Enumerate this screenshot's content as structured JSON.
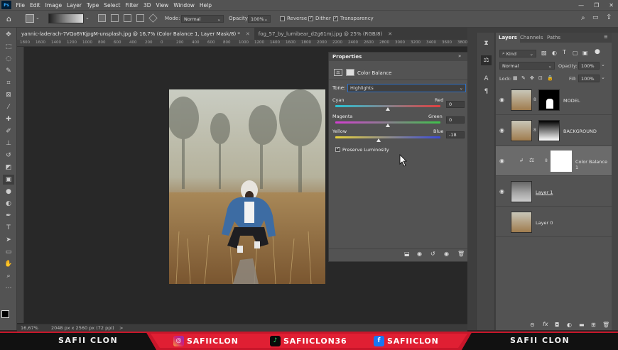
{
  "menu": {
    "items": [
      "File",
      "Edit",
      "Image",
      "Layer",
      "Type",
      "Select",
      "Filter",
      "3D",
      "View",
      "Window",
      "Help"
    ],
    "app_badge": "Ps"
  },
  "options": {
    "mode_label": "Mode:",
    "mode_value": "Normal",
    "opacity_label": "Opacity:",
    "opacity_value": "100%",
    "reverse_label": "Reverse",
    "dither_label": "Dither",
    "transparency_label": "Transparency"
  },
  "tabs": [
    {
      "label": "yannic-laderach-7VQo6YKjpgM-unsplash.jpg @ 16,7% (Color Balance 1, Layer Mask/8) *",
      "active": true
    },
    {
      "label": "fog_57_by_lumibear_d2g61mj.jpg @ 25% (RGB/8)",
      "active": false
    }
  ],
  "ruler": [
    "1800",
    "1600",
    "1400",
    "1200",
    "1000",
    "800",
    "600",
    "400",
    "200",
    "0",
    "200",
    "400",
    "600",
    "800",
    "1000",
    "1200",
    "1400",
    "1600",
    "1800",
    "2000",
    "2200",
    "2400",
    "2600",
    "2800",
    "3000",
    "3200",
    "3400",
    "3600",
    "3800"
  ],
  "status": {
    "zoom": "16,67%",
    "doc_size": "2048 px x 2560 px (72 ppi)",
    "arrow": ">"
  },
  "properties": {
    "title": "Properties",
    "adjustment_name": "Color Balance",
    "tone_label": "Tone:",
    "tone_value": "Highlights",
    "sliders": [
      {
        "left": "Cyan",
        "right": "Red",
        "value": "0",
        "level": 0
      },
      {
        "left": "Magenta",
        "right": "Green",
        "value": "0",
        "level": 0
      },
      {
        "left": "Yellow",
        "right": "Blue",
        "value": "-18",
        "level": -18
      }
    ],
    "preserve_label": "Preserve Luminosity",
    "preserve_checked": true
  },
  "layers_panel": {
    "tabs": [
      "Layers",
      "Channels",
      "Paths"
    ],
    "filter_value": "Kind",
    "blend_mode": "Normal",
    "opacity_label": "Opacity:",
    "opacity_value": "100%",
    "lock_label": "Lock:",
    "fill_label": "Fill:",
    "fill_value": "100%",
    "layers": [
      {
        "name": "MODEL",
        "visible": true,
        "selected": false
      },
      {
        "name": "BACKGROUND",
        "visible": true,
        "selected": false
      },
      {
        "name": "Color Balance 1",
        "visible": true,
        "selected": true
      },
      {
        "name": "Layer 1",
        "visible": true,
        "selected": false
      },
      {
        "name": "Layer 0",
        "visible": false,
        "selected": false
      }
    ]
  },
  "footer": {
    "left_name": "SAFII CLON",
    "instagram": "SAFIICLON",
    "tiktok": "SAFIICLON36",
    "facebook": "SAFIICLON",
    "right_name": "SAFII CLON"
  },
  "colors": {
    "ui_dark": "#282828",
    "ui_panel": "#535353",
    "accent_red": "#d01a2a",
    "selection": "#6b6b6b"
  }
}
